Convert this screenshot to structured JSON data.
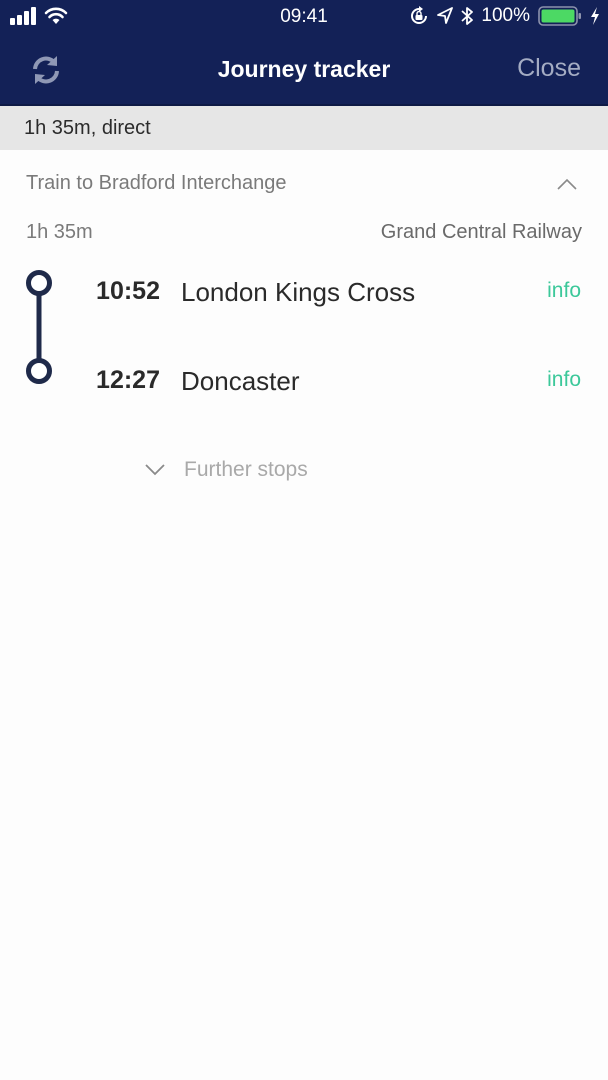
{
  "status_bar": {
    "time": "09:41",
    "battery_percent": "100%",
    "battery_level": 1.0,
    "icons": [
      "signal-icon",
      "wifi-icon",
      "rotation-lock-icon",
      "location-icon",
      "bluetooth-icon",
      "battery-icon",
      "charging-icon"
    ]
  },
  "nav": {
    "title": "Journey tracker",
    "close_label": "Close",
    "refresh_icon": "refresh-icon"
  },
  "summary": {
    "text": "1h 35m, direct"
  },
  "leg": {
    "title": "Train to Bradford Interchange",
    "duration": "1h 35m",
    "operator": "Grand Central Railway",
    "collapse_icon": "chevron-up-icon",
    "stops": [
      {
        "time": "10:52",
        "name": "London Kings Cross",
        "info_label": "info"
      },
      {
        "time": "12:27",
        "name": "Doncaster",
        "info_label": "info"
      }
    ],
    "further_stops_label": "Further stops"
  },
  "colors": {
    "header_bg": "#132157",
    "accent_info": "#3cc89a",
    "timeline": "#1f2a4a",
    "battery_fill": "#4cd964"
  }
}
